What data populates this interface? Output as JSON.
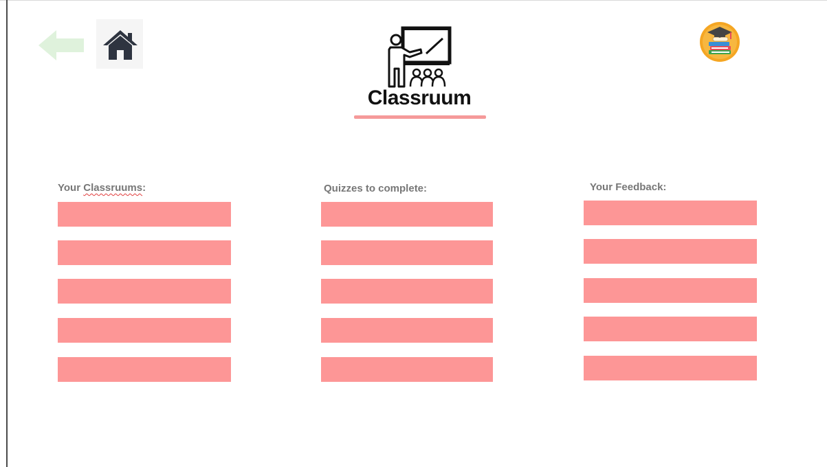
{
  "header": {
    "title": "Classruum",
    "back_icon": "back-arrow-icon",
    "home_icon": "home-icon",
    "logo_icon": "teacher-blackboard-icon",
    "profile_icon": "graduation-books-icon",
    "accent_color": "#fd9696",
    "underline_color": "#f59a9a",
    "back_arrow_color": "#dff2dc"
  },
  "columns": [
    {
      "label_prefix": "Your ",
      "label_word": "Classruums",
      "label_suffix": ":",
      "items": [
        "",
        "",
        "",
        "",
        ""
      ]
    },
    {
      "label": "Quizzes to complete:",
      "items": [
        "",
        "",
        "",
        "",
        ""
      ]
    },
    {
      "label": "Your Feedback:",
      "items": [
        "",
        "",
        "",
        "",
        ""
      ]
    }
  ]
}
